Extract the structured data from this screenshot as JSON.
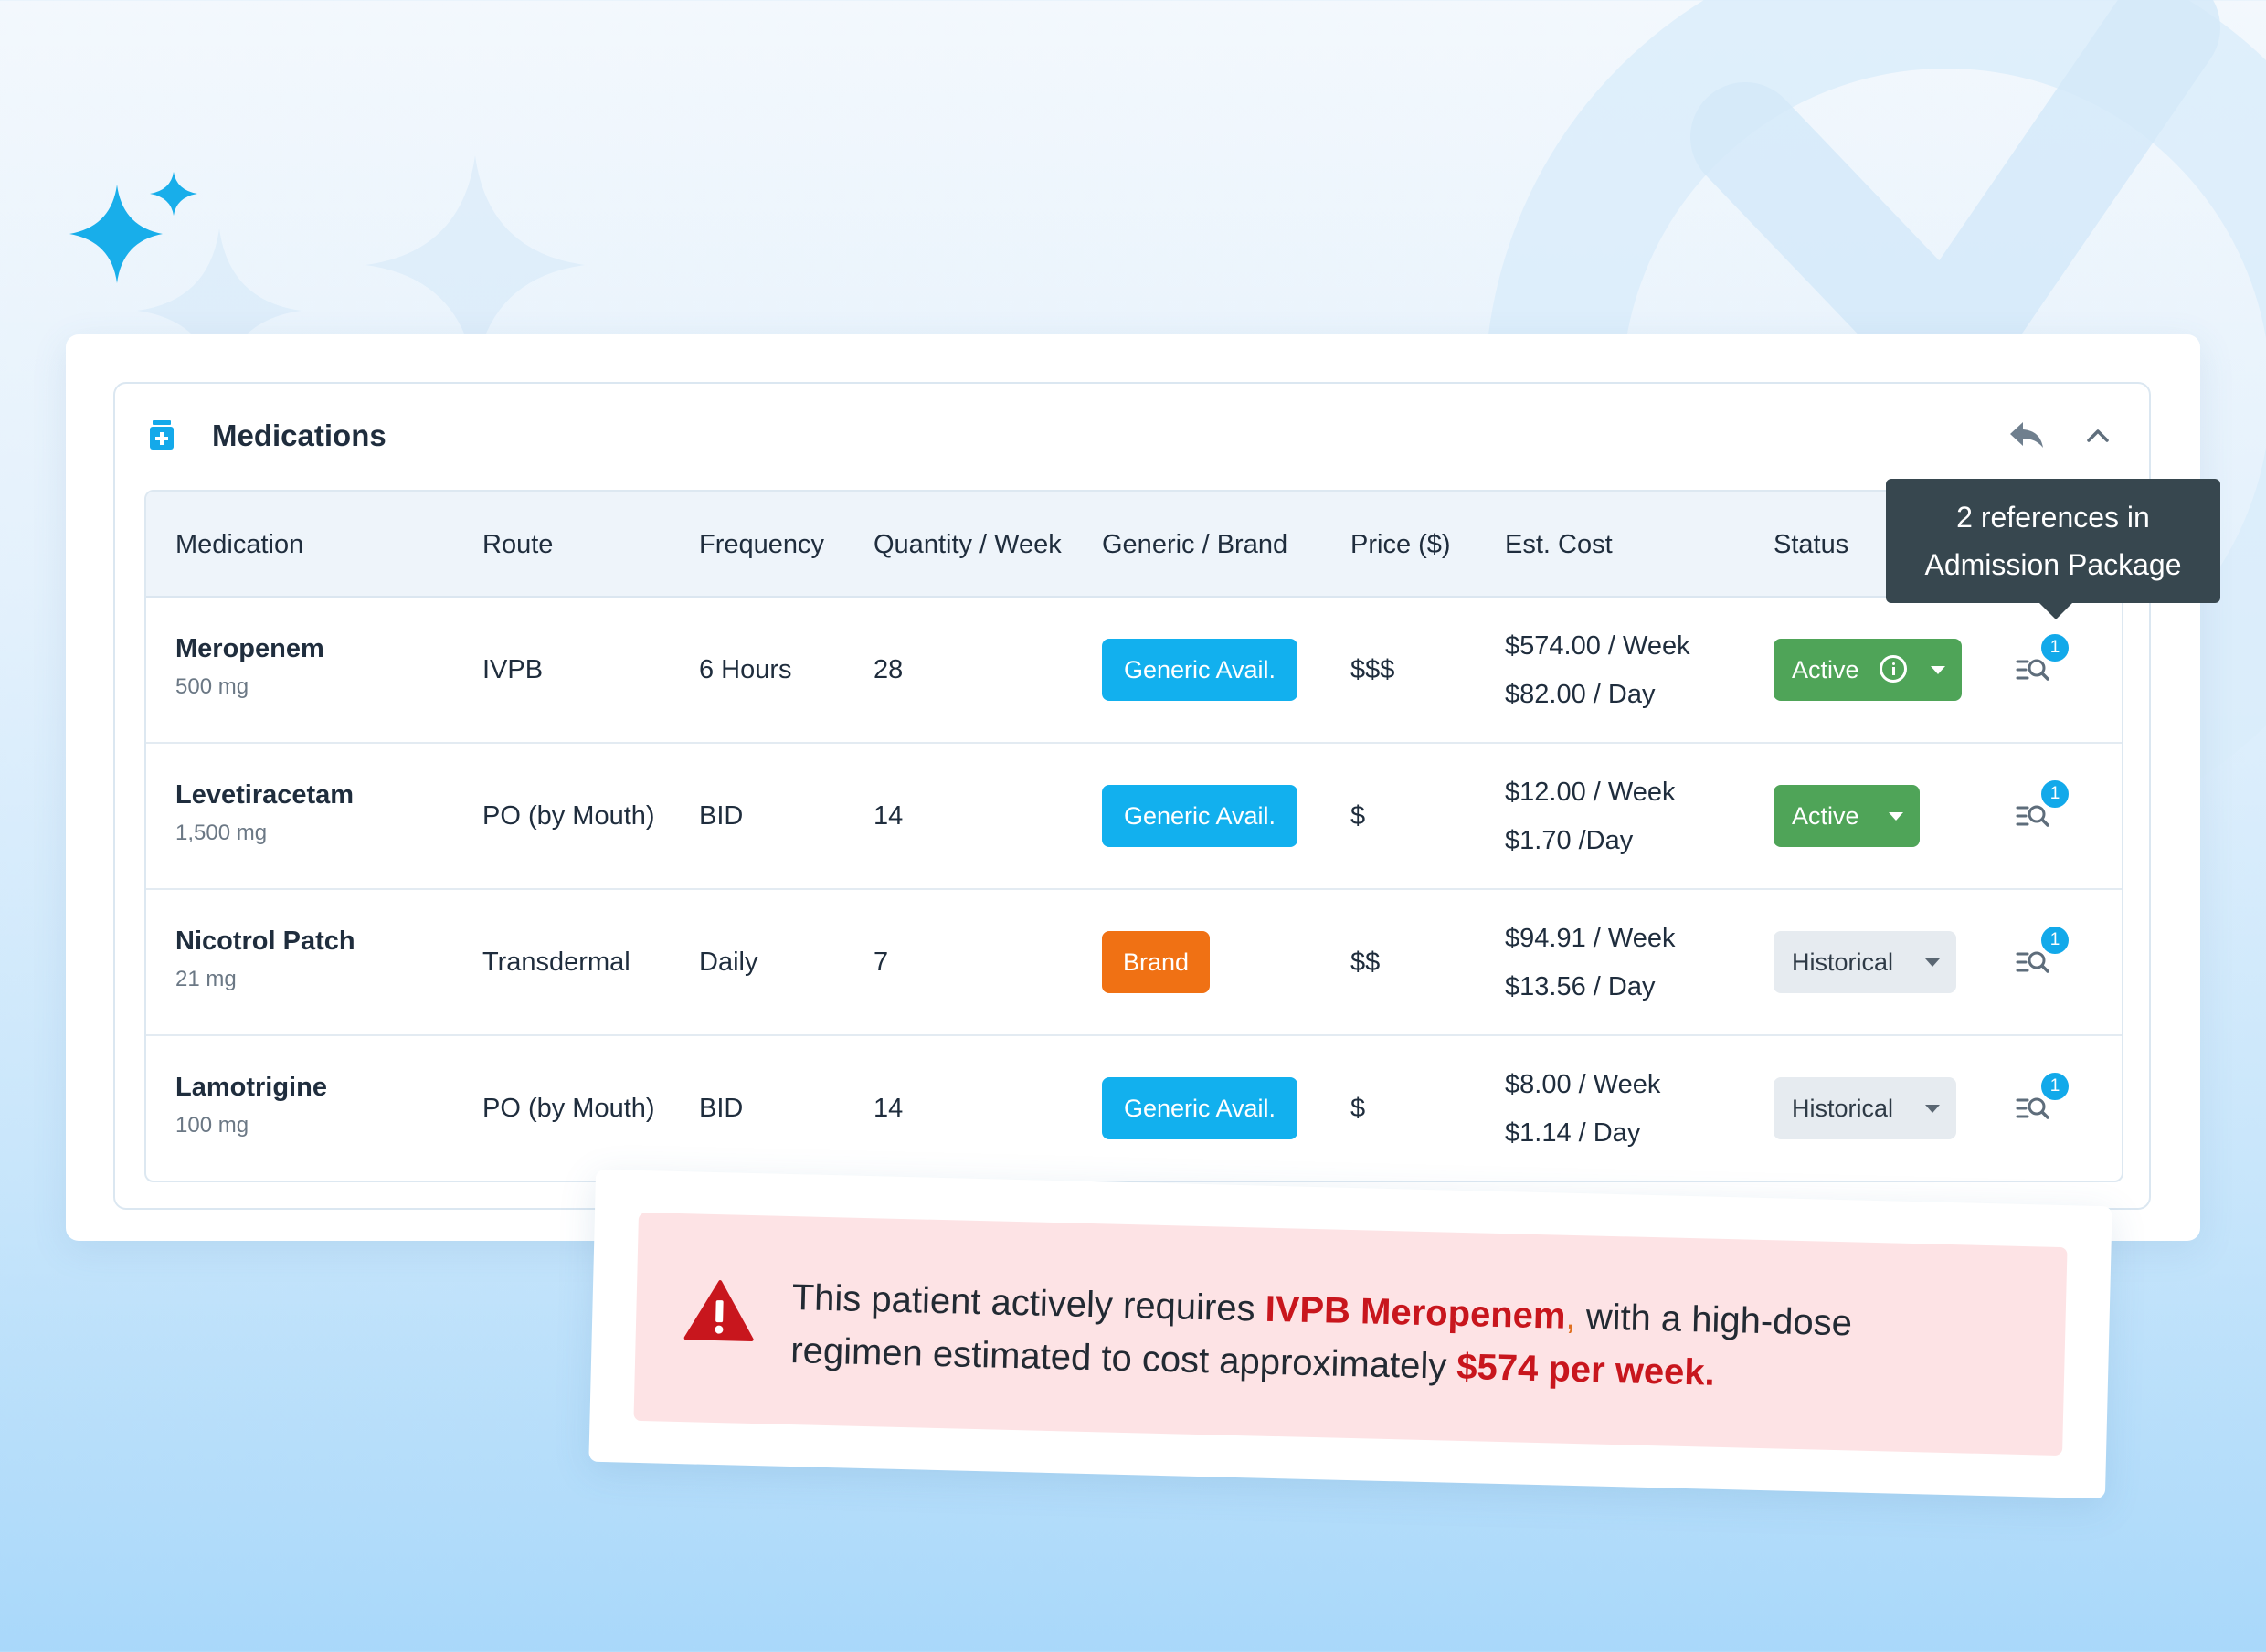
{
  "colors": {
    "accent_blue": "#12b0ee",
    "brand_orange": "#f07114",
    "active_green": "#4fa458",
    "historical_gray": "#e6ebf0",
    "alert_red": "#c8161d",
    "alert_bg": "#fde3e5",
    "tooltip_bg": "#37474f"
  },
  "panel": {
    "title": "Medications",
    "icon": "medication-bottle-icon",
    "reply_icon": "reply-icon",
    "collapse_icon": "chevron-up-icon"
  },
  "table": {
    "columns": [
      "Medication",
      "Route",
      "Frequency",
      "Quantity / Week",
      "Generic / Brand",
      "Price ($)",
      "Est. Cost",
      "Status"
    ],
    "rows": [
      {
        "name": "Meropenem",
        "dose": "500 mg",
        "route": "IVPB",
        "frequency": "6 Hours",
        "quantity": "28",
        "generic_brand": "Generic Avail.",
        "generic_brand_type": "generic",
        "price": "$$$",
        "cost_week": "$574.00 / Week",
        "cost_day": "$82.00 / Day",
        "status": "Active",
        "status_type": "active",
        "status_info_icon": true,
        "references": "1"
      },
      {
        "name": "Levetiracetam",
        "dose": "1,500 mg",
        "route": "PO (by Mouth)",
        "frequency": "BID",
        "quantity": "14",
        "generic_brand": "Generic Avail.",
        "generic_brand_type": "generic",
        "price": "$",
        "cost_week": "$12.00 / Week",
        "cost_day": "$1.70 /Day",
        "status": "Active",
        "status_type": "active",
        "status_info_icon": false,
        "references": "1"
      },
      {
        "name": "Nicotrol Patch",
        "dose": "21 mg",
        "route": "Transdermal",
        "frequency": "Daily",
        "quantity": "7",
        "generic_brand": "Brand",
        "generic_brand_type": "brand",
        "price": "$$",
        "cost_week": "$94.91 / Week",
        "cost_day": "$13.56 / Day",
        "status": "Historical",
        "status_type": "historical",
        "status_info_icon": false,
        "references": "1"
      },
      {
        "name": "Lamotrigine",
        "dose": "100 mg",
        "route": "PO (by Mouth)",
        "frequency": "BID",
        "quantity": "14",
        "generic_brand": "Generic Avail.",
        "generic_brand_type": "generic",
        "price": "$",
        "cost_week": "$8.00 / Week",
        "cost_day": "$1.14 / Day",
        "status": "Historical",
        "status_type": "historical",
        "status_info_icon": false,
        "references": "1"
      }
    ]
  },
  "tooltip": {
    "line1": "2 references in",
    "line2": "Admission Package"
  },
  "alert": {
    "icon": "warning-triangle-icon",
    "part1": "This patient actively requires ",
    "highlight1": "IVPB Meropenem",
    "comma": ",",
    "part2": " with a high-dose regimen estimated to cost approximately ",
    "highlight2": "$574 per week."
  }
}
